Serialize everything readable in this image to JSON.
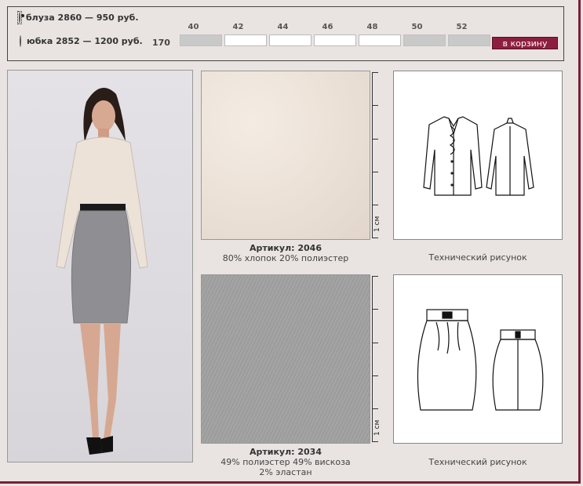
{
  "options": [
    {
      "label": "блуза  2860 — 950 руб.",
      "selected": true
    },
    {
      "label": "юбка  2852 — 1200 руб.",
      "selected": false
    }
  ],
  "sizes": [
    {
      "label": "40",
      "available": false
    },
    {
      "label": "42",
      "available": true
    },
    {
      "label": "44",
      "available": true
    },
    {
      "label": "46",
      "available": true
    },
    {
      "label": "48",
      "available": true
    },
    {
      "label": "50",
      "available": false
    },
    {
      "label": "52",
      "available": false
    }
  ],
  "height_label": "170",
  "cart_button": "в корзину",
  "fabric1": {
    "article": "Артикул: 2046",
    "composition": "80% хлопок 20% полиэстер",
    "scale": "1 см",
    "color": "#ece3da"
  },
  "fabric2": {
    "article": "Артикул: 2034",
    "composition_line1": "49% полиэстер 49% вискоза",
    "composition_line2": "2% эластан",
    "scale": "1 см",
    "color": "#a3a3a3"
  },
  "tech_caption1": "Технический рисунок",
  "tech_caption2": "Технический рисунок",
  "colors": {
    "accent": "#8c1f3f",
    "border": "#7a1f35",
    "background": "#e9e4e2"
  }
}
